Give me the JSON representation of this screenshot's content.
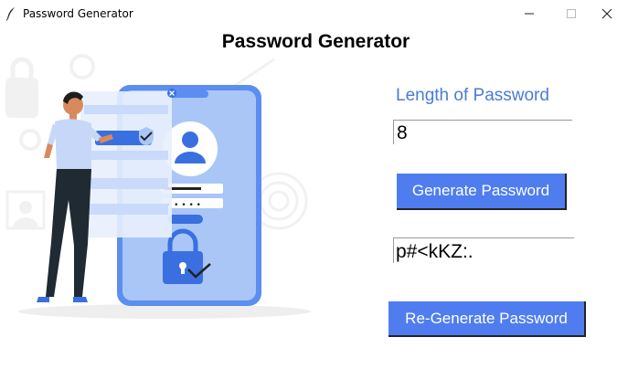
{
  "window": {
    "title": "Password Generator",
    "icon": "feather-icon",
    "controls": [
      "minimize-icon",
      "maximize-icon",
      "close-icon"
    ]
  },
  "header": {
    "title": "Password Generator"
  },
  "illustration": {
    "name": "password-security-illustration",
    "password_dots": "• • • • •"
  },
  "form": {
    "length_label": "Length of Password",
    "length_value": "8",
    "generate_label": "Generate Password",
    "password_value": "p#<kKZ:.",
    "regenerate_label": "Re-Generate Password"
  },
  "colors": {
    "accent": "#4f7df0",
    "label": "#4a7bd8",
    "phone": "#7aa7f2"
  }
}
